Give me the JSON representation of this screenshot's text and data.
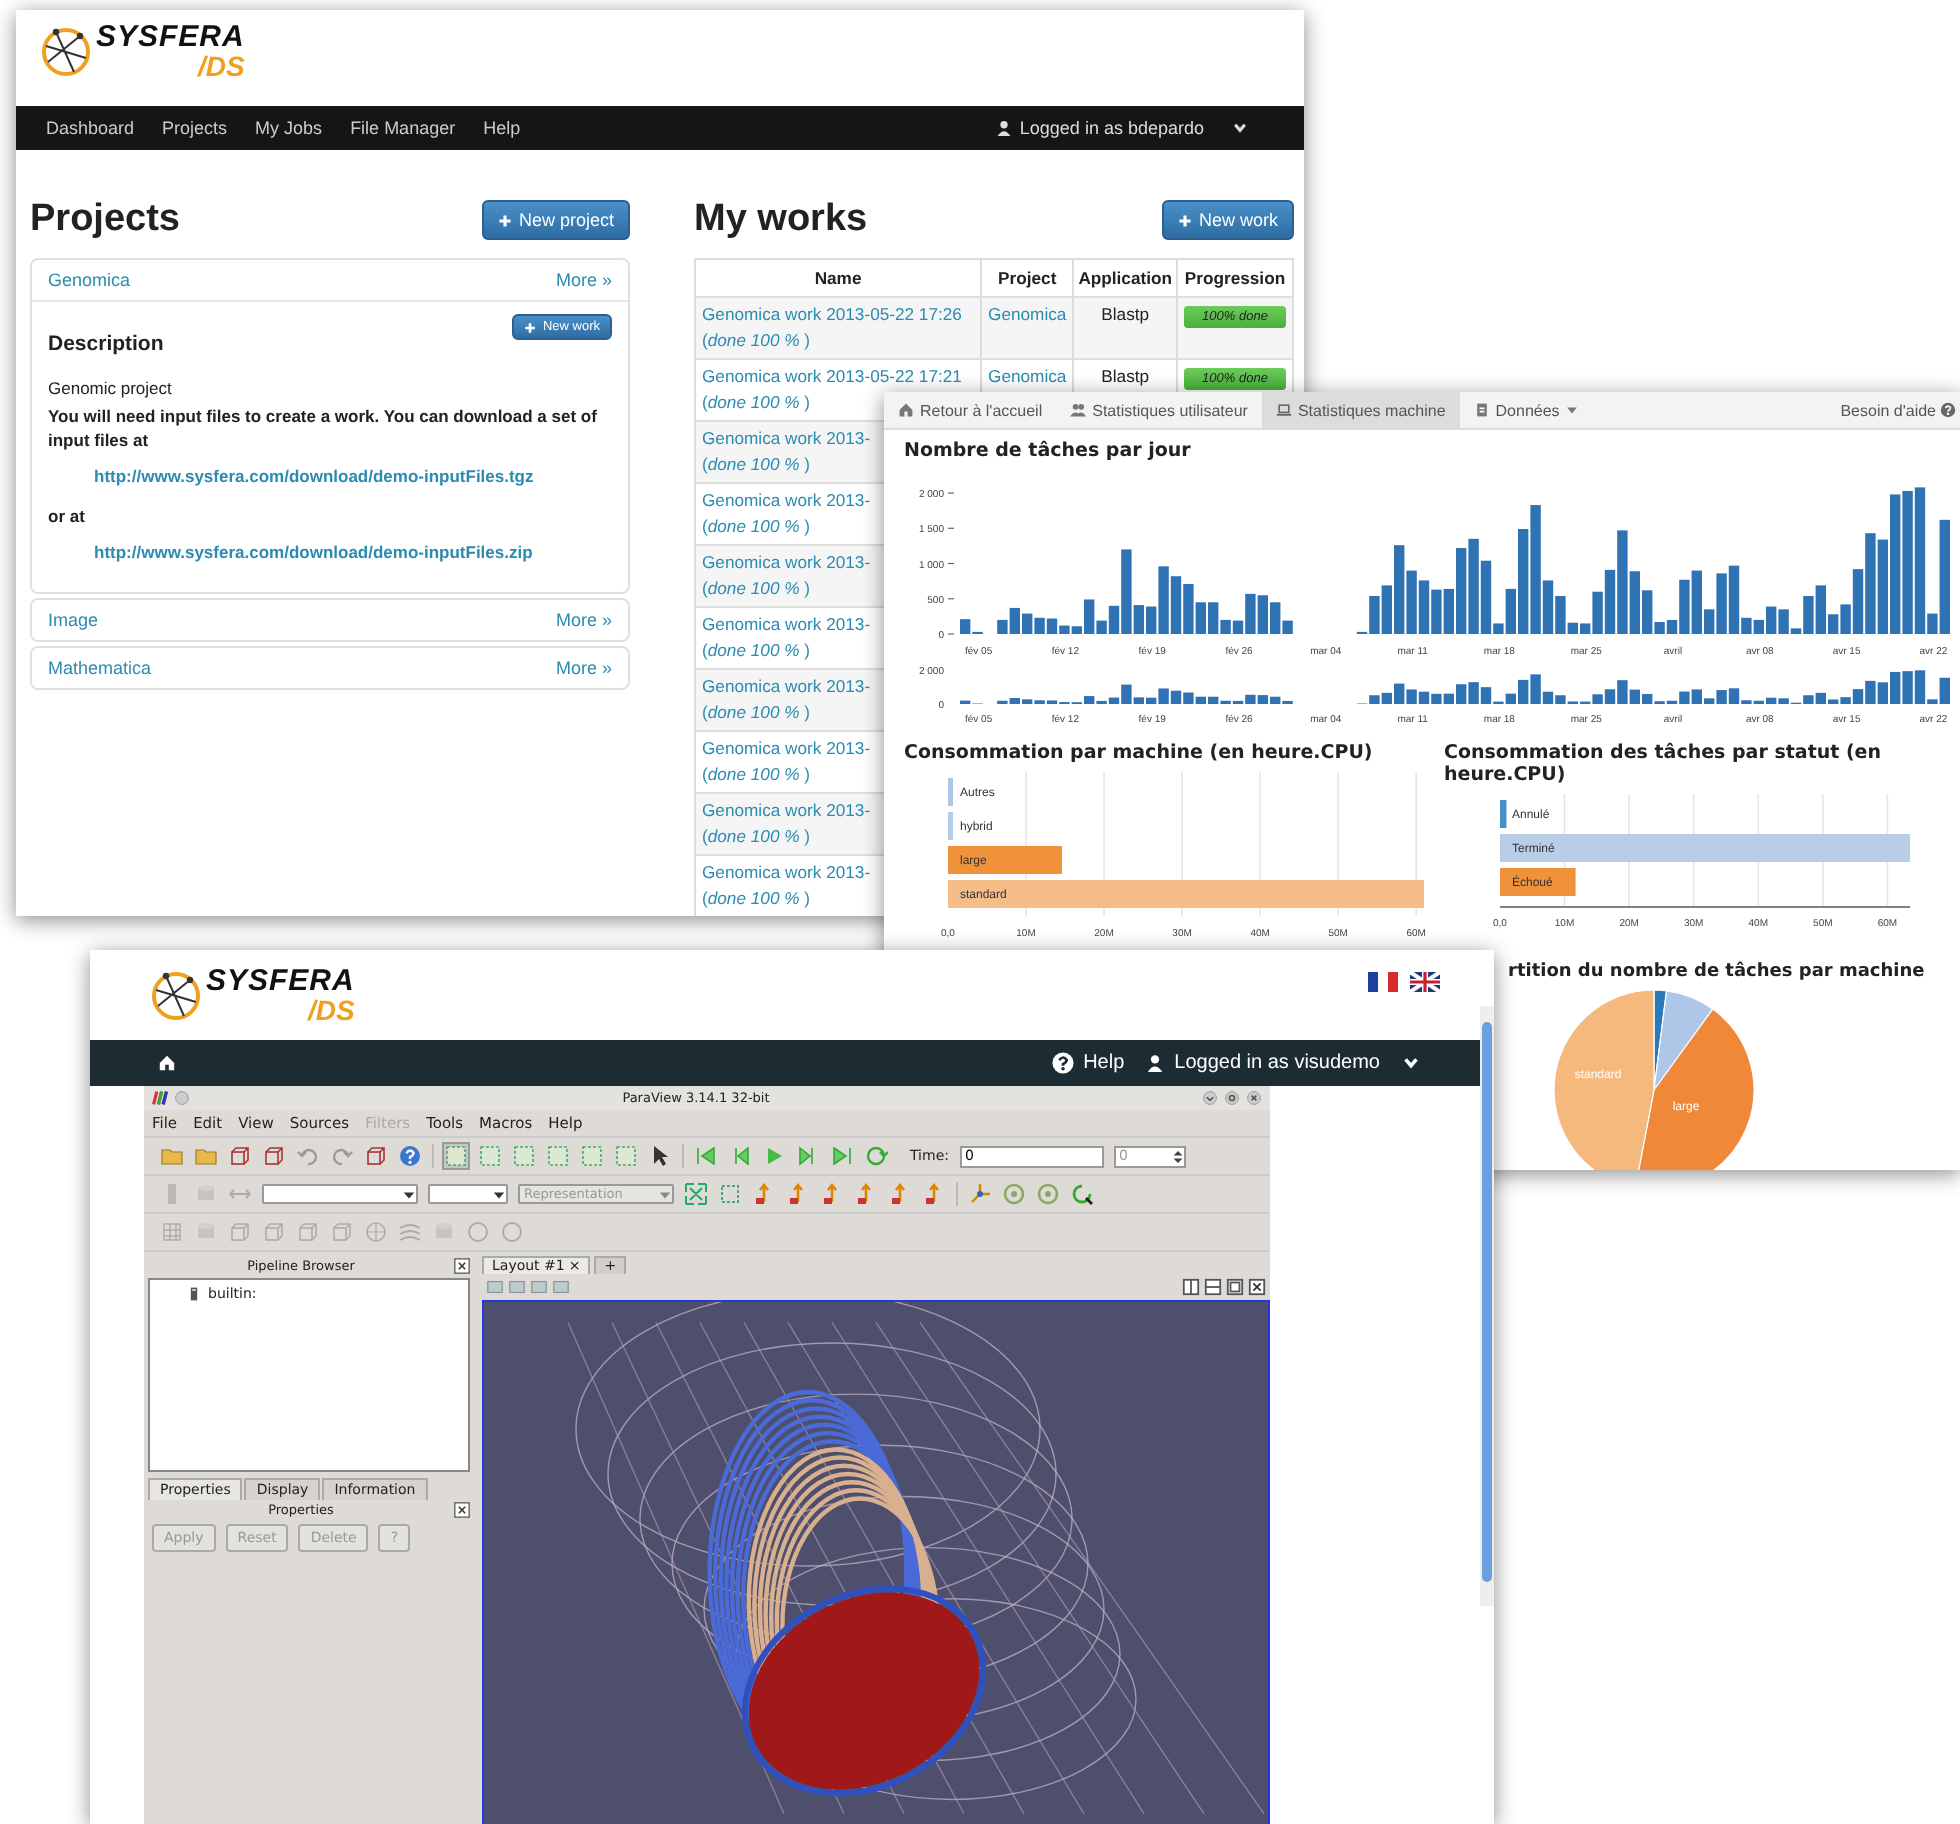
{
  "portal_window": {
    "logo": {
      "name": "SYSFERA",
      "suffix": "/DS"
    },
    "nav": {
      "items": [
        {
          "label": "Dashboard"
        },
        {
          "label": "Projects"
        },
        {
          "label": "My Jobs"
        },
        {
          "label": "File Manager"
        },
        {
          "label": "Help"
        }
      ],
      "user": "Logged in as bdepardo"
    },
    "projects": {
      "title": "Projects",
      "new_button": "New project",
      "items": [
        {
          "name": "Genomica",
          "more": "More »",
          "expanded": true,
          "description": {
            "new_button": "New work",
            "heading": "Description",
            "lines": [
              {
                "kind": "plain",
                "text": "Genomic project"
              },
              {
                "kind": "bold",
                "text": "You will need input files to create a work. You can download a set of input files at"
              },
              {
                "kind": "link",
                "text": "http://www.sysfera.com/download/demo-inputFiles.tgz"
              },
              {
                "kind": "bold",
                "text": "or at"
              },
              {
                "kind": "link",
                "text": "http://www.sysfera.com/download/demo-inputFiles.zip"
              }
            ]
          }
        },
        {
          "name": "Image",
          "more": "More »",
          "expanded": false
        },
        {
          "name": "Mathematica",
          "more": "More »",
          "expanded": false
        }
      ]
    },
    "works": {
      "title": "My works",
      "new_button": "New work",
      "table": {
        "columns": [
          "Name",
          "Project",
          "Application",
          "Progression"
        ],
        "rows": [
          {
            "name": "Genomica work 2013-05-22 17:26",
            "status": "(*done 100 %* )",
            "project": "Genomica",
            "application": "Blastp",
            "progress": {
              "label": "100% done",
              "level": 1
            }
          },
          {
            "name": "Genomica work 2013-05-22 17:21",
            "status": "(*done 100 %* )",
            "project": "Genomica",
            "application": "Blastp",
            "progress": {
              "label": "100% done",
              "level": 1
            }
          },
          {
            "name": "Genomica work 2013-",
            "status": "(*done 100 %* )"
          },
          {
            "name": "Genomica work 2013-",
            "status": "(*done 100 %* )"
          },
          {
            "name": "Genomica work 2013-",
            "status": "(*done 100 %* )"
          },
          {
            "name": "Genomica work 2013-",
            "status": "(*done 100 %* )"
          },
          {
            "name": "Genomica work 2013-",
            "status": "(*done 100 %* )"
          },
          {
            "name": "Genomica work 2013-",
            "status": "(*done 100 %* )"
          },
          {
            "name": "Genomica work 2013-",
            "status": "(*done 100 %* )"
          },
          {
            "name": "Genomica work 2013-",
            "status": "(*done 100 %* )"
          }
        ]
      }
    }
  },
  "stats_window": {
    "tabs": [
      {
        "label": "Retour à l'accueil",
        "kind": "home",
        "selected": false
      },
      {
        "label": "Statistiques utilisateur",
        "kind": "users",
        "selected": false
      },
      {
        "label": "Statistiques machine",
        "kind": "laptop",
        "selected": true
      },
      {
        "label": "Données",
        "kind": "menu",
        "selected": false
      }
    ],
    "help": "Besoin d'aide",
    "daily_chart": {
      "chart_data": {
        "type": "bar",
        "title": "Nombre de tâches par jour",
        "values": [
          210,
          30,
          0,
          200,
          370,
          290,
          230,
          220,
          120,
          110,
          490,
          190,
          400,
          1200,
          410,
          390,
          960,
          820,
          710,
          450,
          450,
          200,
          190,
          570,
          550,
          450,
          190,
          0,
          0,
          0,
          0,
          0,
          30,
          540,
          690,
          1260,
          900,
          760,
          630,
          640,
          1220,
          1350,
          1040,
          150,
          640,
          1490,
          1830,
          760,
          540,
          160,
          150,
          600,
          910,
          1470,
          890,
          620,
          170,
          200,
          770,
          900,
          350,
          860,
          970,
          230,
          200,
          390,
          350,
          80,
          540,
          690,
          280,
          420,
          920,
          1430,
          1340,
          1980,
          2030,
          2080,
          290,
          1620
        ],
        "ylim": [
          0,
          2100
        ],
        "yticks": [
          {
            "value": 0,
            "label": "0"
          },
          {
            "value": 500,
            "label": "500"
          },
          {
            "value": 1000,
            "label": "1 000"
          },
          {
            "value": 1500,
            "label": "1 500"
          },
          {
            "value": 2000,
            "label": "2 000"
          }
        ],
        "categories": [
          null,
          "fév 05",
          null,
          null,
          null,
          null,
          null,
          null,
          "fév 12",
          null,
          null,
          null,
          null,
          null,
          null,
          "fév 19",
          null,
          null,
          null,
          null,
          null,
          null,
          "fév 26",
          null,
          null,
          null,
          null,
          null,
          null,
          "mar 04",
          null,
          null,
          null,
          null,
          null,
          null,
          "mar 11",
          null,
          null,
          null,
          null,
          null,
          null,
          "mar 18",
          null,
          null,
          null,
          null,
          null,
          null,
          "mar 25",
          null,
          null,
          null,
          null,
          null,
          null,
          "avril",
          null,
          null,
          null,
          null,
          null,
          null,
          "avr 08",
          null,
          null,
          null,
          null,
          null,
          null,
          "avr 15",
          null,
          null,
          null,
          null,
          null,
          null,
          "avr 22",
          null
        ]
      }
    },
    "overview": {
      "y_labels": [
        "2 000",
        "0"
      ],
      "x_labels": [
        "fév 05",
        "fév 12",
        "fév 19",
        "fév 26",
        "mar 04",
        "mar 11",
        "mar 18",
        "mar 25",
        "avril",
        "avr 08",
        "avr 15",
        "avr 22"
      ]
    },
    "machine_chart": {
      "chart_data": {
        "type": "bar",
        "orientation": "horizontal",
        "stacked": true,
        "grid": true,
        "title": "Consommation par machine (en heure.CPU)",
        "categories": [
          "Autres",
          "hybrid",
          "large",
          "standard"
        ],
        "series": [
          {
            "color": "#aec7e8",
            "values": [
              0.3,
              null,
              null,
              null
            ]
          },
          {
            "color": "#b4cbe9",
            "values": [
              null,
              0.3,
              null,
              null
            ]
          },
          {
            "color": "#f0913c",
            "values": [
              null,
              null,
              14.6,
              null
            ]
          },
          {
            "color": "#f5bd88",
            "values": [
              null,
              null,
              null,
              61
            ]
          }
        ],
        "xlim": [
          0,
          61
        ],
        "xticks": [
          {
            "value": 0,
            "label": "0,0"
          },
          {
            "value": 10,
            "label": "10M"
          },
          {
            "value": 20,
            "label": "20M"
          },
          {
            "value": 30,
            "label": "30M"
          },
          {
            "value": 40,
            "label": "40M"
          },
          {
            "value": 50,
            "label": "50M"
          },
          {
            "value": 60,
            "label": "60M"
          }
        ]
      }
    },
    "status_chart": {
      "chart_data": {
        "type": "bar",
        "orientation": "horizontal",
        "stacked": true,
        "grid": true,
        "title": "Consommation des tâches par statut (en heure.CPU)",
        "categories": [
          "Annulé",
          "Terminé",
          "Échoué"
        ],
        "series": [
          {
            "color": "#4a8fc4",
            "values": [
              1,
              null,
              null
            ]
          },
          {
            "color": "#b9cde9",
            "values": [
              null,
              63.5,
              null
            ]
          },
          {
            "color": "#f0913c",
            "values": [
              null,
              null,
              11.7
            ]
          }
        ],
        "xlim": [
          0,
          63.5
        ],
        "xticks": [
          {
            "value": 0,
            "label": "0,0"
          },
          {
            "value": 10,
            "label": "10M"
          },
          {
            "value": 20,
            "label": "20M"
          },
          {
            "value": 30,
            "label": "30M"
          },
          {
            "value": 40,
            "label": "40M"
          },
          {
            "value": 50,
            "label": "50M"
          },
          {
            "value": 60,
            "label": "60M"
          }
        ]
      }
    },
    "pie": {
      "title": "rtition du nombre de tâches par machine",
      "labels": [
        "standard",
        "large"
      ]
    }
  },
  "visual_window": {
    "logo": {
      "name": "SYSFERA",
      "suffix": "/DS"
    },
    "nav": {
      "help": "Help",
      "user": "Logged in as visudemo"
    },
    "paraview": {
      "title": "ParaView 3.14.1 32-bit",
      "menu": [
        {
          "label": "File",
          "disabled": false
        },
        {
          "label": "Edit",
          "disabled": false
        },
        {
          "label": "View",
          "disabled": false
        },
        {
          "label": "Sources",
          "disabled": false
        },
        {
          "label": "Filters",
          "disabled": true
        },
        {
          "label": "Tools",
          "disabled": false
        },
        {
          "label": "Macros",
          "disabled": false
        },
        {
          "label": "Help",
          "disabled": false
        }
      ],
      "time": {
        "label": "Time:",
        "value": "0",
        "step": "0"
      },
      "representation": {
        "text": "Representation",
        "disabled": true
      },
      "pipeline": {
        "title": "Pipeline Browser",
        "items": [
          "builtin:"
        ]
      },
      "panel_tabs": [
        {
          "label": "Properties",
          "selected": true
        },
        {
          "label": "Display",
          "selected": false
        },
        {
          "label": "Information",
          "selected": false
        }
      ],
      "properties": {
        "title": "Properties",
        "buttons": [
          {
            "label": "Apply",
            "disabled": true
          },
          {
            "label": "Reset",
            "disabled": true
          },
          {
            "label": "Delete",
            "disabled": true
          },
          {
            "label": "?",
            "disabled": true
          }
        ]
      },
      "layout_tabs": [
        {
          "label": "Layout #1",
          "close": "×",
          "selected": true
        },
        {
          "label": "+",
          "selected": false
        }
      ]
    }
  }
}
